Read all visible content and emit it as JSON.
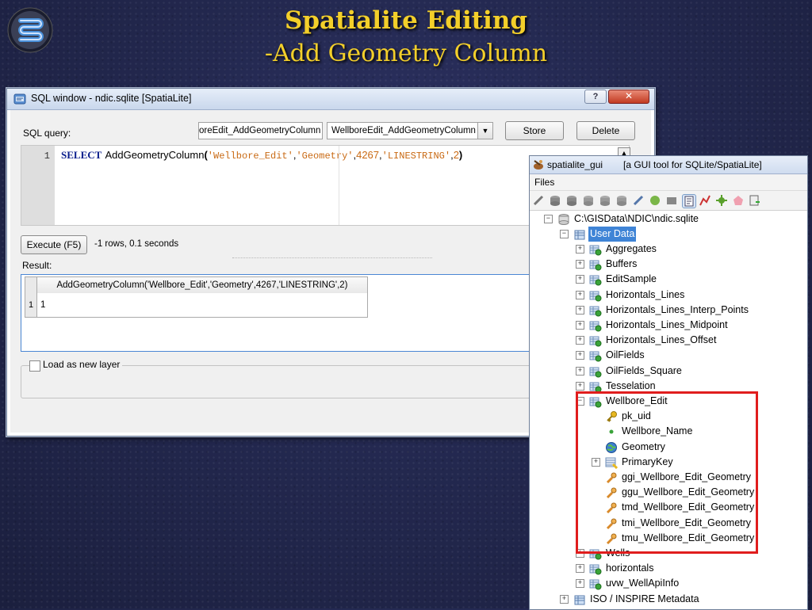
{
  "slide": {
    "title": "Spatialite Editing",
    "subtitle": "-Add Geometry Column"
  },
  "sql_window": {
    "title": "SQL window - ndic.sqlite [SpatiaLite]",
    "help_label": "?",
    "close_label": "✕",
    "sql_query_label": "SQL query:",
    "query_name_value": "oreEdit_AddGeometryColumn",
    "stored_query_selected": "WellboreEdit_AddGeometryColumn",
    "store_label": "Store",
    "delete_label": "Delete",
    "editor": {
      "line_number": "1",
      "keyword": "SELECT",
      "function": "AddGeometryColumn",
      "open_paren": "(",
      "arg1": "'Wellbore_Edit'",
      "comma1": ",",
      "arg2": "'Geometry'",
      "comma2": ",",
      "arg3": "4267",
      "comma3": ",",
      "arg4": "'LINESTRING'",
      "comma4": ",",
      "arg5": "2",
      "close_paren": ")"
    },
    "execute_label": "Execute (F5)",
    "execution_stats": "-1 rows, 0.1 seconds",
    "result_label": "Result:",
    "result_columns": [
      "AddGeometryColumn('Wellbore_Edit','Geometry',4267,'LINESTRING',2)"
    ],
    "result_rows": [
      {
        "row": "1",
        "value": "1"
      }
    ],
    "load_as_layer_label": "Load as new layer",
    "load_as_layer_checked": false
  },
  "gui_window": {
    "title": "spatialite_gui",
    "subtitle": "[a GUI tool for SQLite/SpatiaLite]",
    "menu": [
      "Files"
    ],
    "tree": {
      "db_path": "C:\\GISData\\NDIC\\ndic.sqlite",
      "user_data": "User Data",
      "tables": [
        "Aggregates",
        "Buffers",
        "EditSample",
        "Horizontals_Lines",
        "Horizontals_Lines_Interp_Points",
        "Horizontals_Lines_Midpoint",
        "Horizontals_Lines_Offset",
        "OilFields",
        "OilFields_Square",
        "Tesselation"
      ],
      "expanded_table": "Wellbore_Edit",
      "columns": [
        {
          "name": "pk_uid",
          "icon": "key-icon"
        },
        {
          "name": "Wellbore_Name",
          "icon": "column-dot-icon"
        },
        {
          "name": "Geometry",
          "icon": "globe-icon"
        },
        {
          "name": "PrimaryKey",
          "icon": "index-icon"
        },
        {
          "name": "ggi_Wellbore_Edit_Geometry",
          "icon": "trigger-icon"
        },
        {
          "name": "ggu_Wellbore_Edit_Geometry",
          "icon": "trigger-icon"
        },
        {
          "name": "tmd_Wellbore_Edit_Geometry",
          "icon": "trigger-icon"
        },
        {
          "name": "tmi_Wellbore_Edit_Geometry",
          "icon": "trigger-icon"
        },
        {
          "name": "tmu_Wellbore_Edit_Geometry",
          "icon": "trigger-icon"
        }
      ],
      "after_tables": [
        "Wells",
        "horizontals",
        "uvw_WellApiInfo"
      ],
      "metadata": "ISO / INSPIRE Metadata"
    }
  },
  "colors": {
    "title_yellow": "#f3cf2a",
    "highlight_red": "#e01d1d",
    "selection_blue": "#3f84d6",
    "sql_keyword": "#0a1e8c",
    "sql_string": "#c96a14"
  }
}
